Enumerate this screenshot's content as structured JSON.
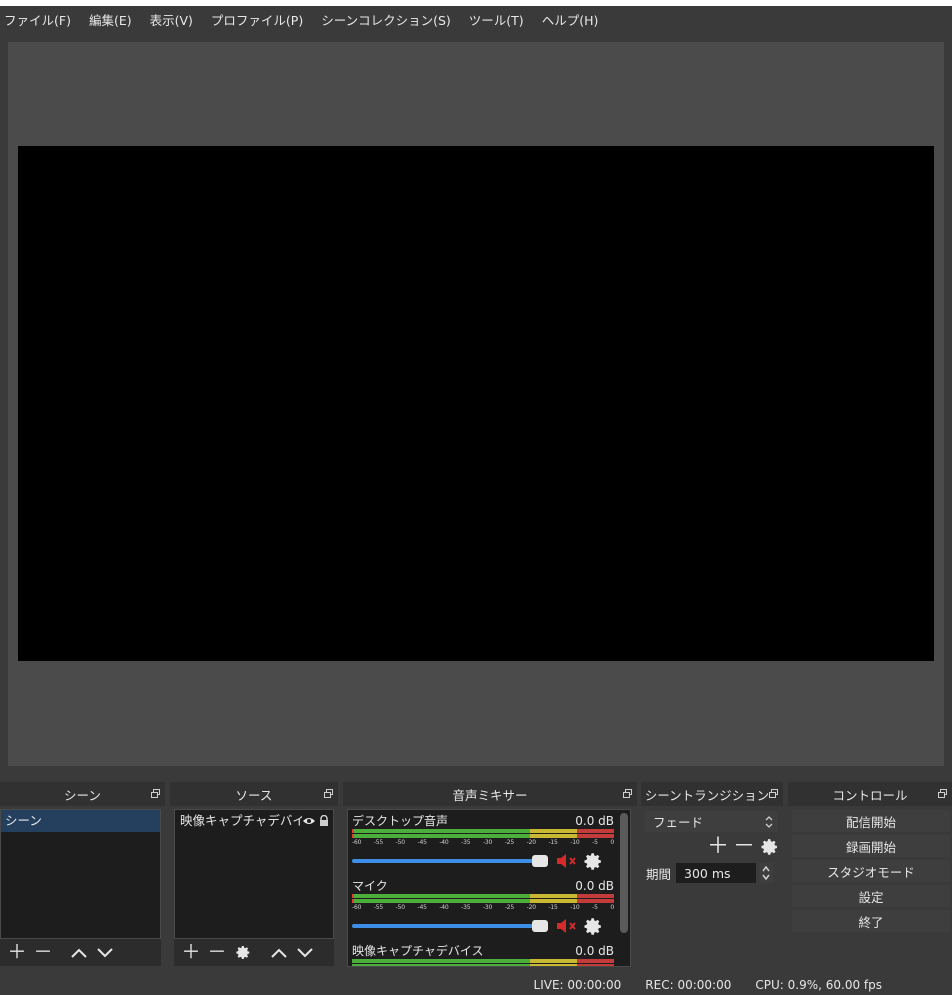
{
  "menu": [
    "ファイル(F)",
    "編集(E)",
    "表示(V)",
    "プロファイル(P)",
    "シーンコレクション(S)",
    "ツール(T)",
    "ヘルプ(H)"
  ],
  "docks": {
    "scenes": {
      "title": "シーン",
      "items": [
        "シーン"
      ],
      "selected_index": 0
    },
    "sources": {
      "title": "ソース",
      "items": [
        {
          "label": "映像キャプチャデバイ",
          "visible": true,
          "locked": true
        }
      ]
    },
    "mixer": {
      "title": "音声ミキサー",
      "channels": [
        {
          "name": "デスクトップ音声",
          "level": "0.0 dB",
          "muted": true
        },
        {
          "name": "マイク",
          "level": "0.0 dB",
          "muted": true
        },
        {
          "name": "映像キャプチャデバイス",
          "level": "0.0 dB",
          "muted": false
        }
      ],
      "ticks": [
        "-60",
        "-55",
        "-50",
        "-45",
        "-40",
        "-35",
        "-30",
        "-25",
        "-20",
        "-15",
        "-10",
        "-5",
        "0"
      ]
    },
    "transitions": {
      "title": "シーントランジション",
      "selected": "フェード",
      "duration_label": "期間",
      "duration_value": "300 ms"
    },
    "controls": {
      "title": "コントロール",
      "buttons": [
        "配信開始",
        "録画開始",
        "スタジオモード",
        "設定",
        "終了"
      ]
    }
  },
  "status": {
    "live": "LIVE: 00:00:00",
    "rec": "REC: 00:00:00",
    "cpu": "CPU: 0.9%, 60.00 fps"
  },
  "colors": {
    "background": "#3a3a3a",
    "panel": "#1d1d1d",
    "selection": "#25405e",
    "slider": "#3d8ee6",
    "mute_red": "#d42a2a"
  }
}
